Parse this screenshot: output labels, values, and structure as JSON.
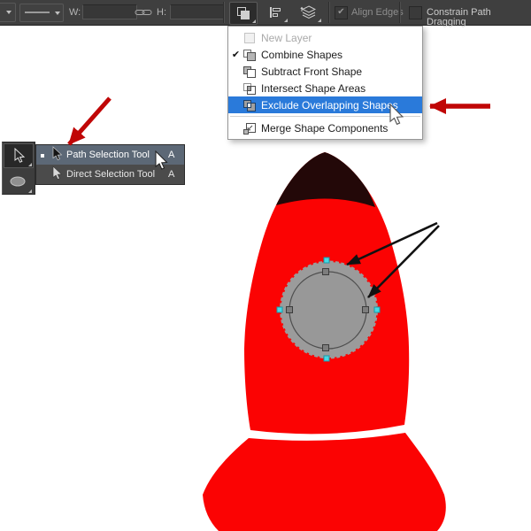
{
  "options_bar": {
    "width_label": "W:",
    "width_value": "",
    "height_label": "H:",
    "height_value": "",
    "align_edges": {
      "label": "Align Edges",
      "checked": true,
      "enabled": false
    },
    "constrain_path_dragging": {
      "label": "Constrain Path Dragging",
      "checked": false
    }
  },
  "path_operations_menu": {
    "items": [
      {
        "label": "New Layer",
        "state": "disabled"
      },
      {
        "label": "Combine Shapes",
        "state": "checked"
      },
      {
        "label": "Subtract Front Shape",
        "state": "normal"
      },
      {
        "label": "Intersect Shape Areas",
        "state": "normal"
      },
      {
        "label": "Exclude Overlapping Shapes",
        "state": "highlighted"
      },
      {
        "label": "Merge Shape Components",
        "state": "normal",
        "separator_before": true
      }
    ]
  },
  "tool_flyout": {
    "items": [
      {
        "label": "Path Selection Tool",
        "shortcut": "A",
        "selected": true
      },
      {
        "label": "Direct Selection Tool",
        "shortcut": "A",
        "selected": false
      }
    ]
  },
  "glyphs": {
    "check": "✔"
  },
  "colors": {
    "options_bar_bg": "#3f3f3f",
    "menu_highlight_blue": "#2a7ada",
    "flyout_highlight": "#5c6876",
    "rocket_red": "#fb0303",
    "nose_cone": "#230808",
    "porthole_gray": "#9b9b9b",
    "anchor_cyan": "#46d9e5",
    "anchor_gray": "#7d7d7d",
    "annotation_arrow_red": "#c00606",
    "annotation_arrow_black": "#111111"
  }
}
